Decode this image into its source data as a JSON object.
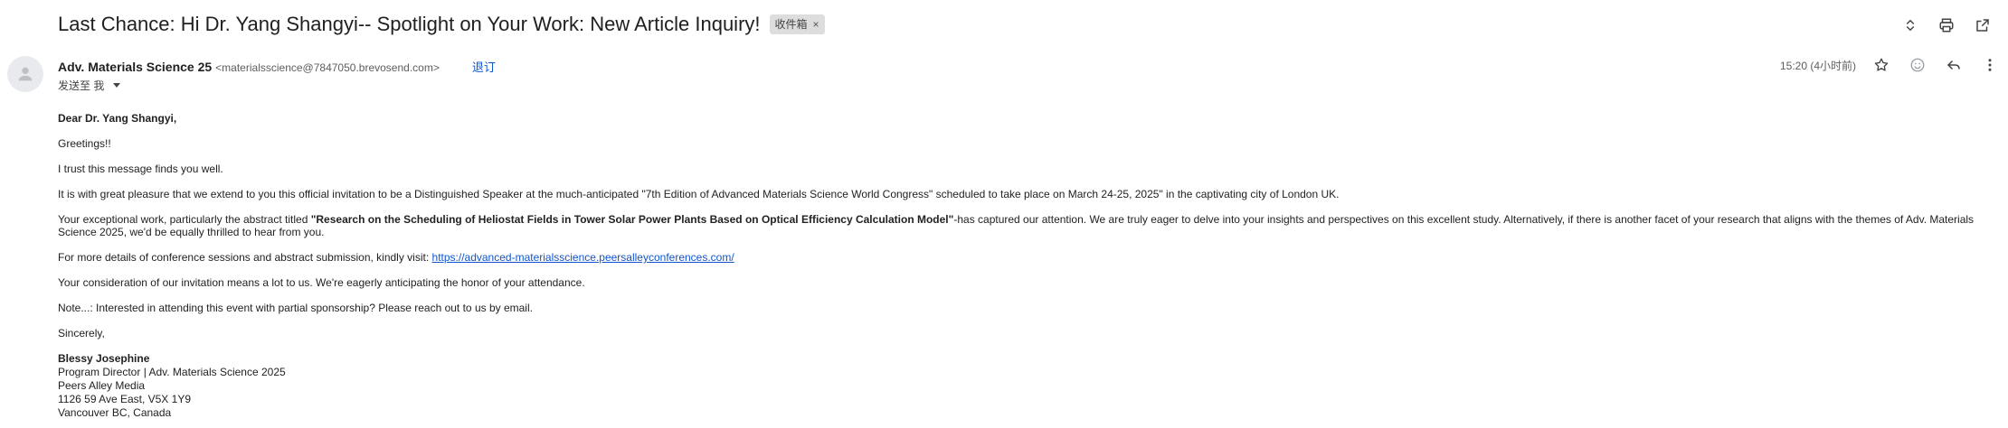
{
  "subject": "Last Chance: Hi Dr. Yang Shangyi-- Spotlight on Your Work: New Article Inquiry!",
  "label_chip": "收件箱",
  "label_chip_close": "×",
  "sender": {
    "name": "Adv. Materials Science 25",
    "email": "<materialsscience@7847050.brevosend.com>",
    "unsubscribe": "退订",
    "to": "发送至 我"
  },
  "timestamp": "15:20 (4小时前)",
  "icons": {
    "top": [
      "expand-collapse-icon",
      "print-icon",
      "open-new-window-icon"
    ],
    "meta": [
      "star-icon",
      "emoji-icon",
      "reply-icon",
      "more-vert-icon"
    ]
  },
  "body": {
    "salutation": "Dear Dr. Yang Shangyi,",
    "greeting": "Greetings!!",
    "line1": "I trust this message finds you well.",
    "line2": "It is with great pleasure that we extend to you this official invitation to be a Distinguished Speaker at the much-anticipated \"7th Edition of Advanced Materials Science World Congress\" scheduled to take place on March 24-25, 2025\" in the captivating city of London UK.",
    "p3_before": "Your exceptional work, particularly the abstract titled ",
    "p3_title": "\"Research on the Scheduling of Heliostat Fields in Tower Solar Power Plants Based on Optical Efficiency Calculation Model\"",
    "p3_after": "-has captured our attention. We are truly eager to delve into your insights and perspectives on this excellent study. Alternatively, if there is another facet of your research that aligns with the themes of Adv. Materials Science 2025, we'd be equally thrilled to hear from you.",
    "p4_before": "For more details of conference sessions and abstract submission, kindly visit: ",
    "p4_link": "https://advanced-materialsscience.peersalleyconferences.com/",
    "line5": "Your consideration of our invitation means a lot to us. We're eagerly anticipating the honor of your attendance.",
    "line6": "Note...: Interested in attending this event with partial sponsorship? Please reach out to us by email.",
    "closing": "Sincerely,",
    "signature": [
      "Blessy Josephine",
      "Program Director | Adv. Materials Science 2025",
      "Peers Alley Media",
      "1126 59 Ave East, V5X 1Y9",
      "Vancouver BC, Canada"
    ]
  }
}
